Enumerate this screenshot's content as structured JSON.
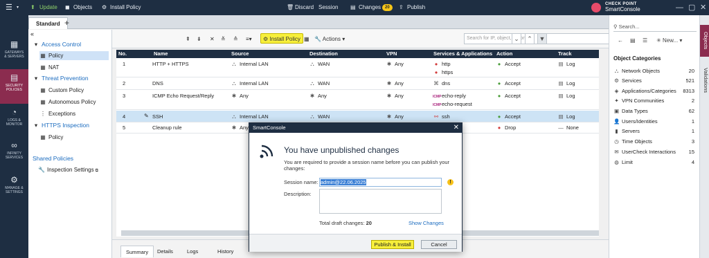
{
  "topbar": {
    "menu_icon": "app-menu-icon",
    "update_label": "Update",
    "objects_label": "Objects",
    "install_policy_label": "Install Policy",
    "discard_label": "Discard",
    "session_label": "Session",
    "changes_label": "Changes",
    "changes_count": "20",
    "publish_label": "Publish",
    "brand_line1": "CHECK POINT",
    "brand_line2": "SmartConsole"
  },
  "leftnav": [
    {
      "label1": "GATEWAYS",
      "label2": "& SERVERS",
      "icon": "gateways-icon"
    },
    {
      "label1": "SECURITY",
      "label2": "POLICIES",
      "icon": "policies-icon"
    },
    {
      "label1": "LOGS &",
      "label2": "MONITOR",
      "icon": "logs-icon"
    },
    {
      "label1": "INFINITY",
      "label2": "SERVICES",
      "icon": "infinity-icon"
    },
    {
      "label1": "MANAGE &",
      "label2": "SETTINGS",
      "icon": "settings-icon"
    }
  ],
  "tabs": {
    "active": "Standard"
  },
  "tree": {
    "access_control": "Access Control",
    "policy": "Policy",
    "nat": "NAT",
    "threat_prevention": "Threat Prevention",
    "custom_policy": "Custom Policy",
    "autonomous_policy": "Autonomous Policy",
    "exceptions": "Exceptions",
    "https_inspection": "HTTPS Inspection",
    "https_policy": "Policy",
    "shared_policies": "Shared Policies",
    "inspection_settings": "Inspection Settings"
  },
  "toolbar": {
    "install_policy": "Install Policy",
    "actions": "Actions",
    "search_placeholder": "Search for IP, object, action, ..."
  },
  "grid": {
    "columns": [
      "No.",
      "Name",
      "Source",
      "Destination",
      "VPN",
      "Services & Applications",
      "Action",
      "Track"
    ],
    "rows": [
      {
        "no": "1",
        "name": "HTTP + HTTPS",
        "source": "Internal LAN",
        "destination": "WAN",
        "vpn": "Any",
        "services": [
          "http",
          "https"
        ],
        "action": "Accept",
        "track": "Log"
      },
      {
        "no": "2",
        "name": "DNS",
        "source": "Internal LAN",
        "destination": "WAN",
        "vpn": "Any",
        "services": [
          "dns"
        ],
        "action": "Accept",
        "track": "Log"
      },
      {
        "no": "3",
        "name": "ICMP Echo Request/Reply",
        "source": "Any",
        "destination": "Any",
        "vpn": "Any",
        "services": [
          "echo-reply",
          "echo-request"
        ],
        "action": "Accept",
        "track": "Log"
      },
      {
        "no": "4",
        "name": "SSH",
        "source": "Internal LAN",
        "destination": "WAN",
        "vpn": "Any",
        "services": [
          "ssh"
        ],
        "action": "Accept",
        "track": "Log"
      },
      {
        "no": "5",
        "name": "Cleanup rule",
        "source": "Any",
        "destination": "",
        "vpn": "",
        "services": [],
        "action": "Drop",
        "track": "None"
      }
    ]
  },
  "bottom_tabs": [
    "Summary",
    "Details",
    "Logs",
    "History"
  ],
  "dialog": {
    "title": "SmartConsole",
    "heading": "You have unpublished changes",
    "message": "You are required to provide a session name before you can publish your changes:",
    "session_name_label": "Session name:",
    "session_name_value": "admin@22.06.2025",
    "description_label": "Description:",
    "drafts_label": "Total draft changes:",
    "drafts_count": "20",
    "show_changes": "Show Changes",
    "publish_install": "Publish & Install",
    "cancel": "Cancel"
  },
  "right_panel": {
    "search_placeholder": "Search...",
    "new_label": "New...",
    "title": "Object Categories",
    "categories": [
      {
        "name": "Network Objects",
        "count": "20"
      },
      {
        "name": "Services",
        "count": "521"
      },
      {
        "name": "Applications/Categories",
        "count": "8313"
      },
      {
        "name": "VPN Communities",
        "count": "2"
      },
      {
        "name": "Data Types",
        "count": "62"
      },
      {
        "name": "Users/Identities",
        "count": "1"
      },
      {
        "name": "Servers",
        "count": "1"
      },
      {
        "name": "Time Objects",
        "count": "3"
      },
      {
        "name": "UserCheck Interactions",
        "count": "15"
      },
      {
        "name": "Limit",
        "count": "4"
      }
    ]
  },
  "side_tabs": [
    "Objects",
    "Validations"
  ],
  "colors": {
    "navy": "#1e2e42",
    "accent": "#8b2c4f",
    "highlight": "#f7ef3b",
    "accept": "#4a9d3a",
    "drop": "#d23a3a"
  }
}
